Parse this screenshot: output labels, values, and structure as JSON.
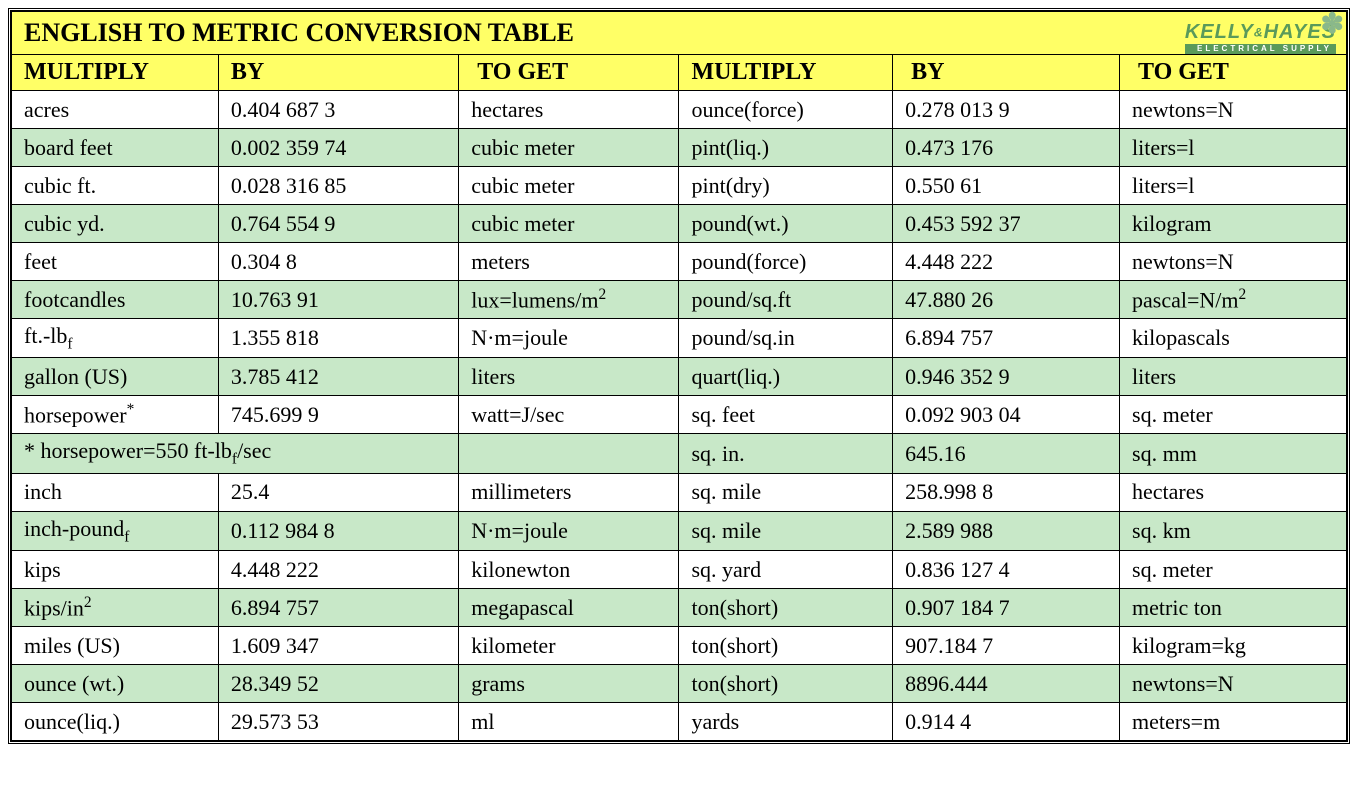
{
  "title": "ENGLISH TO METRIC CONVERSION TABLE",
  "brand": {
    "line1a": "KELLY",
    "amp": "&",
    "line1b": "HAYES",
    "line2": "ELECTRICAL SUPPLY"
  },
  "headers": {
    "mult1": "MULTIPLY",
    "by1": "BY",
    "get1": "TO GET",
    "mult2": "MULTIPLY",
    "by2": "BY",
    "get2": "TO GET"
  },
  "rows": [
    {
      "m1": "acres",
      "b1": "0.404 687 3",
      "g1": "hectares",
      "m2": "ounce(force)",
      "b2": "0.278 013 9",
      "g2": "newtons=N"
    },
    {
      "m1": "board feet",
      "b1": "0.002 359 74",
      "g1": "cubic meter",
      "m2": "pint(liq.)",
      "b2": "0.473 176",
      "g2": "liters=l"
    },
    {
      "m1": "cubic ft.",
      "b1": "0.028 316 85",
      "g1": "cubic meter",
      "m2": "pint(dry)",
      "b2": "0.550 61",
      "g2": "liters=l"
    },
    {
      "m1": "cubic yd.",
      "b1": "0.764 554 9",
      "g1": "cubic meter",
      "m2": "pound(wt.)",
      "b2": "0.453 592 37",
      "g2": "kilogram"
    },
    {
      "m1": "feet",
      "b1": "0.304 8",
      "g1": "meters",
      "m2": "pound(force)",
      "b2": "4.448 222",
      "g2": "newtons=N"
    },
    {
      "m1": "footcandles",
      "b1": "10.763 91",
      "g1_html": "lux=lumens/m<sup>2</sup>",
      "m2": "pound/sq.ft",
      "b2": "47.880 26",
      "g2_html": "pascal=N/m<sup>2</sup>"
    },
    {
      "m1_html": "ft.-lb<sub>f</sub>",
      "b1": "1.355 818",
      "g1": "N·m=joule",
      "m2": "pound/sq.in",
      "b2": "6.894 757",
      "g2": "kilopascals"
    },
    {
      "m1": "gallon (US)",
      "b1": "3.785 412",
      "g1": "liters",
      "m2": "quart(liq.)",
      "b2": "0.946 352 9",
      "g2": "liters"
    },
    {
      "m1_html": "horsepower<sup>*</sup>",
      "b1": "745.699 9",
      "g1": "watt=J/sec",
      "m2": "sq. feet",
      "b2": "0.092 903 04",
      "g2": "sq. meter"
    },
    {
      "note_html": "* horsepower=550 ft-lb<sub>f</sub>/sec",
      "m2": "sq. in.",
      "b2": "645.16",
      "g2": "sq. mm"
    },
    {
      "m1": "inch",
      "b1": "25.4",
      "g1": "millimeters",
      "m2": "sq. mile",
      "b2": "258.998 8",
      "g2": "hectares"
    },
    {
      "m1_html": "inch-pound<sub>f</sub>",
      "b1": "0.112 984 8",
      "g1": "N·m=joule",
      "m2": "sq. mile",
      "b2": "2.589 988",
      "g2": "sq. km"
    },
    {
      "m1": "kips",
      "b1": "4.448 222",
      "g1": "kilonewton",
      "m2": "sq. yard",
      "b2": "0.836 127 4",
      "g2": "sq. meter"
    },
    {
      "m1_html": "kips/in<sup>2</sup>",
      "b1": "6.894 757",
      "g1": "megapascal",
      "m2": "ton(short)",
      "b2": "0.907 184 7",
      "g2": "metric ton"
    },
    {
      "m1": "miles (US)",
      "b1": "1.609 347",
      "g1": "kilometer",
      "m2": "ton(short)",
      "b2": "907.184 7",
      "g2": "kilogram=kg"
    },
    {
      "m1": "ounce (wt.)",
      "b1": "28.349 52",
      "g1": "grams",
      "m2": "ton(short)",
      "b2": "8896.444",
      "g2": "newtons=N"
    },
    {
      "m1": "ounce(liq.)",
      "b1": "29.573 53",
      "g1": "ml",
      "m2": "yards",
      "b2": "0.914 4",
      "g2": "meters=m"
    }
  ]
}
